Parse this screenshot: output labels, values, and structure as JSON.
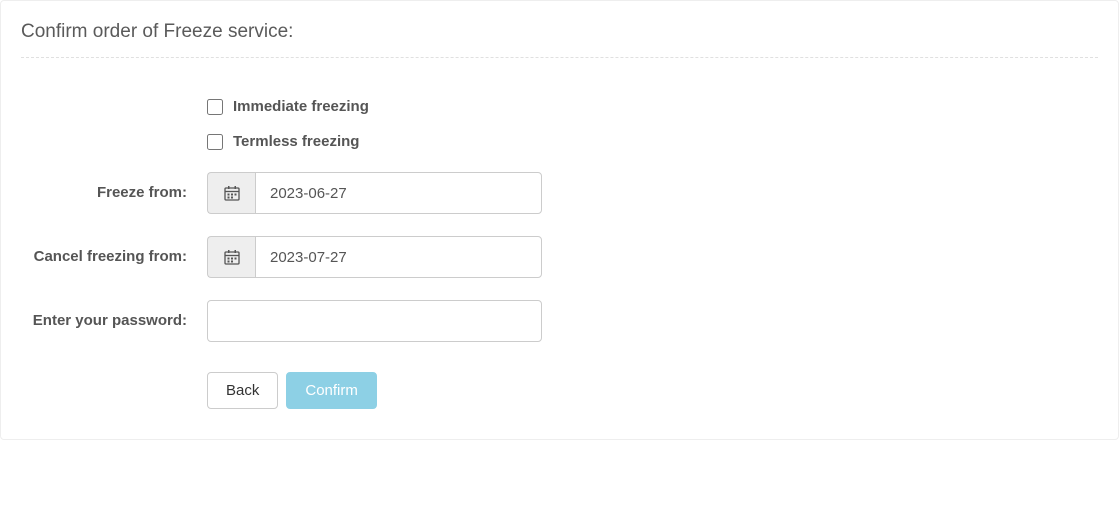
{
  "title": "Confirm order of Freeze service:",
  "checkboxes": {
    "immediate": {
      "label": "Immediate freezing",
      "checked": false
    },
    "termless": {
      "label": "Termless freezing",
      "checked": false
    }
  },
  "fields": {
    "freeze_from": {
      "label": "Freeze from:",
      "value": "2023-06-27"
    },
    "cancel_from": {
      "label": "Cancel freezing from:",
      "value": "2023-07-27"
    },
    "password": {
      "label": "Enter your password:",
      "value": ""
    }
  },
  "buttons": {
    "back": "Back",
    "confirm": "Confirm"
  }
}
